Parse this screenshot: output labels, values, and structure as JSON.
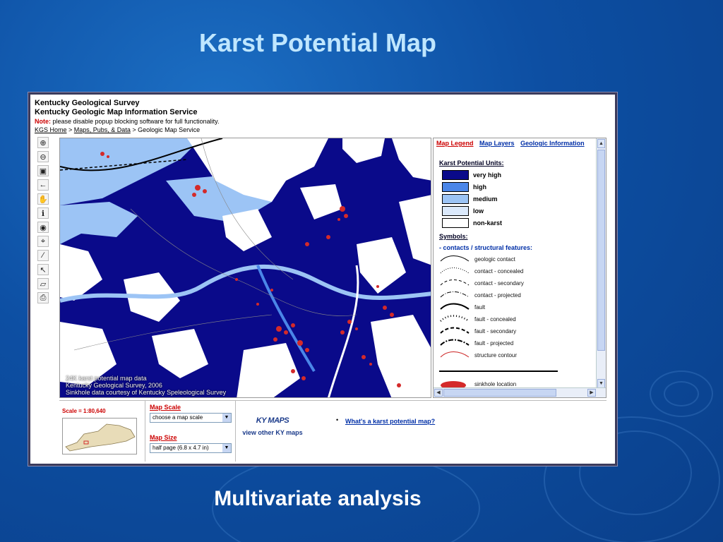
{
  "slide": {
    "title": "Karst Potential Map",
    "caption": "Multivariate analysis"
  },
  "header": {
    "org": "Kentucky Geological Survey",
    "service": "Kentucky Geologic Map Information Service",
    "note_label": "Note:",
    "note_text": " please disable popup blocking software for full functionality.",
    "breadcrumb": [
      "KGS Home",
      "Maps, Pubs, & Data",
      "Geologic Map Service"
    ],
    "breadcrumb_sep": " > "
  },
  "map": {
    "credits": [
      "24K karst potential map data",
      "Kentucky Geological Survey, 2006",
      "Sinkhole data courtesy of Kentucky Speleological Survey"
    ]
  },
  "legend": {
    "tabs": [
      "Map Legend",
      "Map Layers",
      "Geologic Information"
    ],
    "active_tab": "Map Legend",
    "units_title": "Karst Potential Units:",
    "units": [
      {
        "label": "very high",
        "color": "#0a0a8a"
      },
      {
        "label": "high",
        "color": "#4a86e8"
      },
      {
        "label": "medium",
        "color": "#9cc4f5"
      },
      {
        "label": "low",
        "color": "#dbe9fb"
      },
      {
        "label": "non-karst",
        "color": "#ffffff"
      }
    ],
    "symbols_title": "Symbols:",
    "contacts_title": "- contacts / structural features:",
    "symbols": [
      "geologic contact",
      "contact - concealed",
      "contact - secondary",
      "contact - projected",
      "fault",
      "fault - concealed",
      "fault - secondary",
      "fault - projected",
      "structure contour"
    ],
    "sinkhole_label": "sinkhole location"
  },
  "bottom": {
    "scale": "Scale = 1:80,640",
    "map_scale_label": "Map Scale",
    "map_scale_value": "choose a map scale",
    "map_size_label": "Map Size",
    "map_size_value": "half page (6.8 x 4.7 in)",
    "kymaps_logo": "KY MAPS",
    "kymaps_link": "view other KY maps",
    "whatis_link": "What's a karst potential map?"
  },
  "colors": {
    "very_high": "#0a0a8a",
    "high": "#4a86e8",
    "medium": "#9cc4f5",
    "sinkhole": "#d42a2a"
  }
}
